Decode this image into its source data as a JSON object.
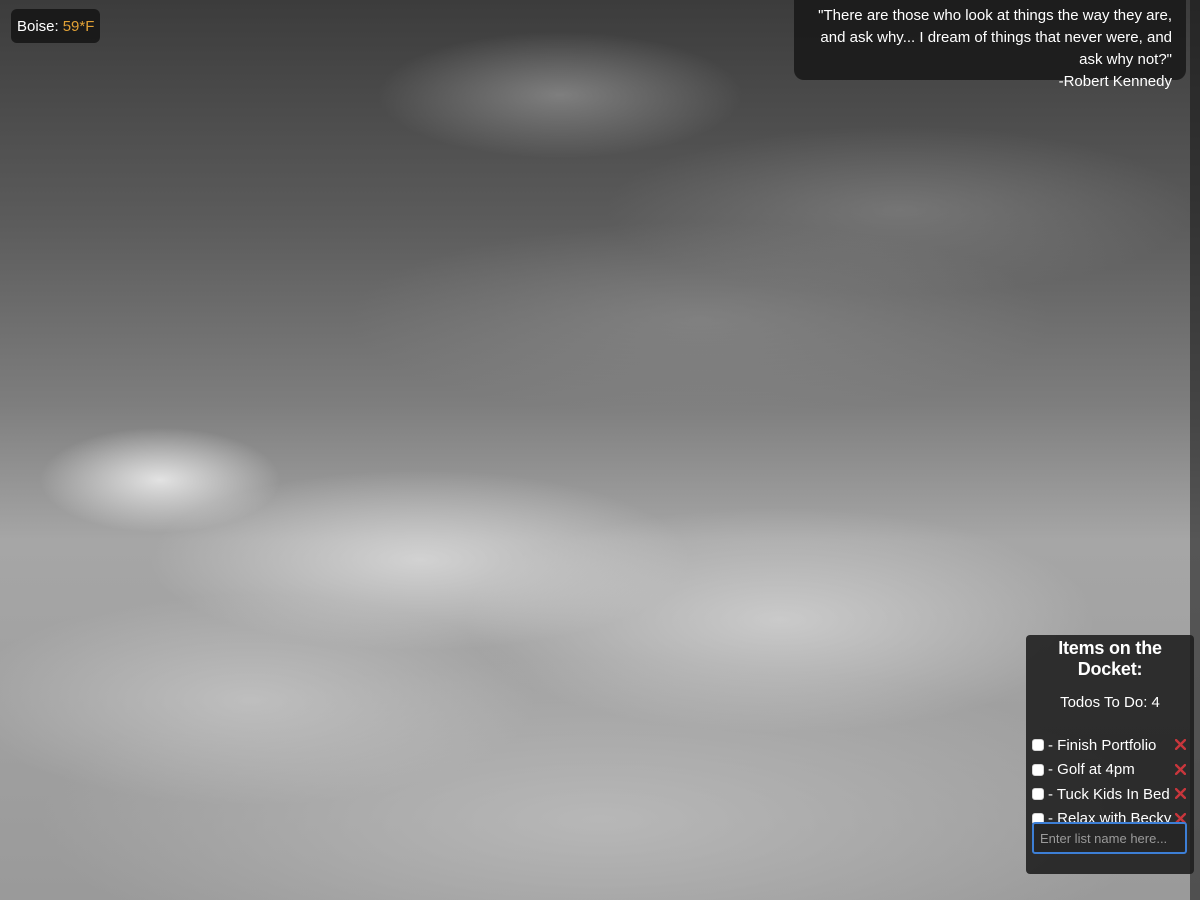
{
  "weather": {
    "city_label": "Boise:",
    "temperature": "59*F",
    "temperature_color": "#e1a135"
  },
  "quote": {
    "text": "\"There are those who look at things the way they are, and ask why... I dream of things that never were, and ask why not?\"",
    "author": "-Robert Kennedy"
  },
  "docket": {
    "title": "Items on the Docket:",
    "count_text": "Todos To Do: 4",
    "items": [
      {
        "label": "- Finish Portfolio",
        "checked": false,
        "remove_icon": "close-icon"
      },
      {
        "label": "- Golf at 4pm",
        "checked": false,
        "remove_icon": "close-icon"
      },
      {
        "label": "- Tuck Kids In Bed",
        "checked": false,
        "remove_icon": "close-icon"
      },
      {
        "label": "- Relax with Becky",
        "checked": false,
        "remove_icon": "close-icon"
      }
    ],
    "input_placeholder": "Enter list name here...",
    "remove_icon_color": "#c8363c",
    "input_border_color": "#3d7fd6"
  }
}
